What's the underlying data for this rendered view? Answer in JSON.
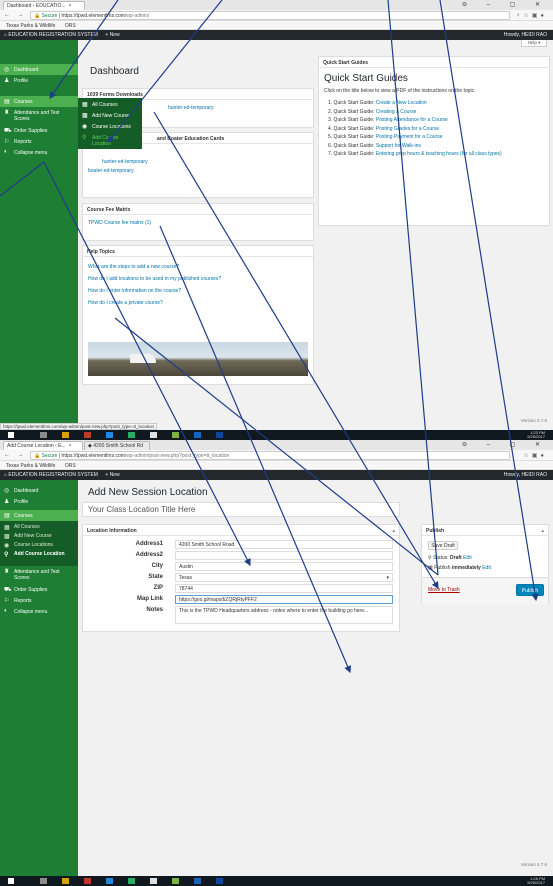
{
  "colors": {
    "sidebar": "#1e7e34",
    "active": "#4caf50",
    "adminbar": "#23282d",
    "link": "#0073aa",
    "primary": "#0085ba",
    "arrow": "#1f3c88"
  },
  "shot1": {
    "tab_title": "Dashboard ‹ EDUCATIO...",
    "url_secure": "Secure",
    "url_host": "https://tpwd.elementlms.com",
    "url_path": "/wp-admin/",
    "bookmarks": [
      "Texas Parks & Wildlife",
      "ORS"
    ],
    "admin_bar": {
      "site": "EDUCATION REGISTRATION SYSTEM",
      "new": "+ New",
      "howdy": "Howdy, HEIDI RAO"
    },
    "help": "Help ▾",
    "page_title": "Dashboard",
    "sidebar": [
      "Dashboard",
      "Profile",
      "Courses",
      "Attendance and Test Scores",
      "Order Supplies",
      "Reports",
      "Collapse menu"
    ],
    "dropdown": [
      "All Courses",
      "Add New Course",
      "Course Locations",
      "Add Course Location"
    ],
    "panels": {
      "forms": {
        "title": "1039 Forms Downloads",
        "items": [
          "hunter-ed-temporary"
        ]
      },
      "cards": {
        "title": "and Boater Education Cards",
        "items": [
          "hunter-ed-temporary",
          "boater-ed-temporary"
        ]
      },
      "fee": {
        "title": "Course Fee Matrix",
        "items": [
          "TPWD Course fee matrix (1)"
        ]
      },
      "help": {
        "title": "Help Topics",
        "items": [
          "What are the steps to add a new course?",
          "How do I add locations to be used in my published courses?",
          "How do I enter information on the course?",
          "How do I create a private course?"
        ]
      },
      "quick": {
        "title": "Quick Start Guides",
        "heading": "Quick Start Guides",
        "intro": "Click on the title below to view a PDF of the instructions on the topic.",
        "items": [
          {
            "n": "1. Quick Start Guide:",
            "t": "Create a New Location"
          },
          {
            "n": "2. Quick Start Guide:",
            "t": "Creating a Course"
          },
          {
            "n": "3. Quick Start Guide:",
            "t": "Posting Attendance for a Course"
          },
          {
            "n": "4. Quick Start Guide:",
            "t": "Posting Grades for a Course"
          },
          {
            "n": "5. Quick Start Guide:",
            "t": "Posting Payment for a Course"
          },
          {
            "n": "6. Quick Start Guide:",
            "t": "Support for Walk-ins"
          },
          {
            "n": "7. Quick Start Guide:",
            "t": "Entering prep hours & teaching hours (for all class types)"
          }
        ]
      }
    },
    "version": "Version 4.7.6",
    "status_url": "https://tpwd.elementlms.com/wp-admin/post-new.php?post_type=tt_location",
    "clock": {
      "time": "1:23 PM",
      "date": "9/25/2017"
    }
  },
  "shot2": {
    "tabs": [
      "Add Course Location ‹ E...",
      "4200 Smith School Rd"
    ],
    "url_secure": "Secure",
    "url_host": "https://tpwd.elementlms.com",
    "url_path": "/wp-admin/post-new.php?post_type=tt_location",
    "bookmarks": [
      "Texas Parks & Wildlife",
      "ORS"
    ],
    "admin_bar": {
      "site": "EDUCATION REGISTRATION SYSTEM",
      "new": "+ New",
      "howdy": "Howdy, HEIDI RAO"
    },
    "page_title": "Add New Session Location",
    "title_placeholder": "Your Class Location Title Here",
    "sidebar": [
      "Dashboard",
      "Profile",
      "Courses",
      "All Courses",
      "Add New Course",
      "Course Locations",
      "Add Course Location",
      "Attendance and Test Scores",
      "Order Supplies",
      "Reports",
      "Collapse menu"
    ],
    "box_title": "Location Information",
    "fields": [
      {
        "label": "Address1",
        "value": "4200 Smith School Road"
      },
      {
        "label": "Address2",
        "value": ""
      },
      {
        "label": "City",
        "value": "Austin"
      },
      {
        "label": "State",
        "value": "Texas"
      },
      {
        "label": "ZIP",
        "value": "78744"
      },
      {
        "label": "Map Link",
        "value": "https://goo.gl/maps/bZQRjRtyPFF2"
      }
    ],
    "notes_label": "Notes",
    "notes_value": "This is the TPWD Headquarters address - notes where to enter the building go here...",
    "publish": {
      "title": "Publish",
      "save_draft": "Save Draft",
      "status_label": "Status:",
      "status": "Draft",
      "edit": "Edit",
      "publish_label": "Publish",
      "immediately": "immediately",
      "trash": "Move to Trash",
      "button": "Publish"
    },
    "version": "Version 4.7.6",
    "clock": {
      "time": "1:28 PM",
      "date": "9/25/2017"
    }
  }
}
